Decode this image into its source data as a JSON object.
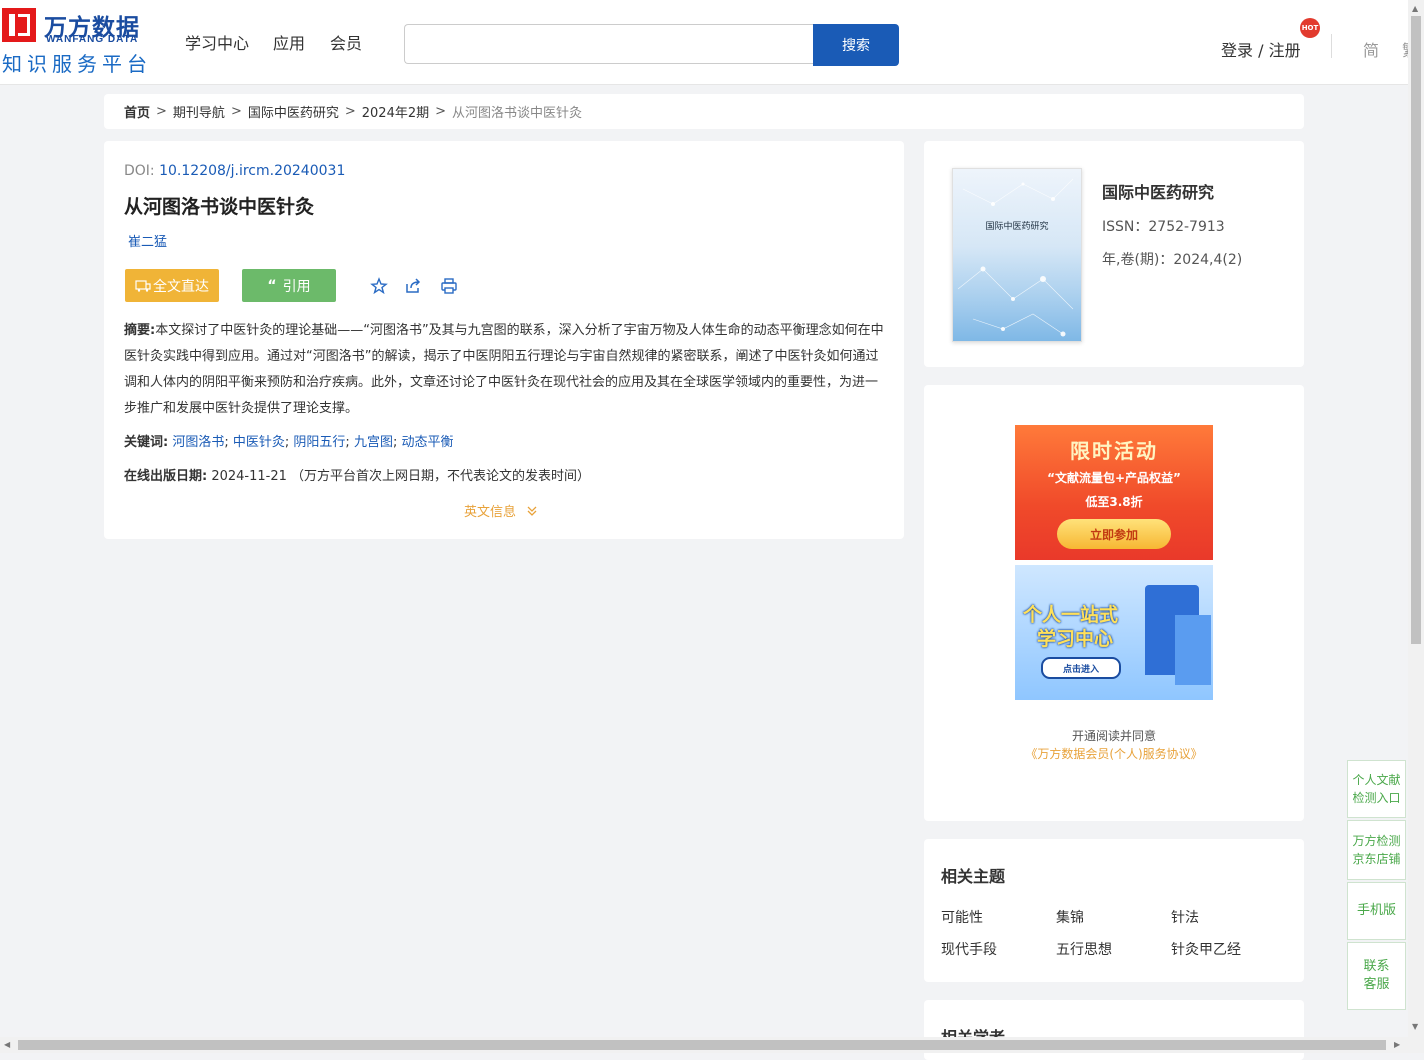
{
  "header": {
    "logo_cn": "万方数据",
    "logo_en": "WANFANG DATA",
    "logo_sub": "知识服务平台",
    "nav": [
      "学习中心",
      "应用",
      "会员"
    ],
    "search_placeholder": "",
    "search_button": "搜索",
    "login": "登录 / 注册",
    "hot_badge": "HOT",
    "lang": "简",
    "lang2": "繁"
  },
  "breadcrumb": {
    "items": [
      "首页",
      "期刊导航",
      "国际中医药研究",
      "2024年2期"
    ],
    "current": "从河图洛书谈中医针灸",
    "separator": ">"
  },
  "article": {
    "doi_label": "DOI: ",
    "doi": "10.12208/j.ircm.20240031",
    "title": "从河图洛书谈中医针灸",
    "author": "崔二猛",
    "btn_fulltext": "全文直达",
    "btn_cite": "引用",
    "abstract_label": "摘要:",
    "abstract": "本文探讨了中医针灸的理论基础——“河图洛书”及其与九宫图的联系，深入分析了宇宙万物及人体生命的动态平衡理念如何在中医针灸实践中得到应用。通过对“河图洛书”的解读，揭示了中医阴阳五行理论与宇宙自然规律的紧密联系，阐述了中医针灸如何通过调和人体内的阴阳平衡来预防和治疗疾病。此外，文章还讨论了中医针灸在现代社会的应用及其在全球医学领域内的重要性，为进一步推广和发展中医针灸提供了理论支撑。",
    "keywords_label": "关键词:",
    "keywords": [
      "河图洛书",
      "中医针灸",
      "阴阳五行",
      "九宫图",
      "动态平衡"
    ],
    "pubdate_label": "在线出版日期:",
    "pubdate": "2024-11-21",
    "pubdate_note": "（万方平台首次上网日期，不代表论文的发表时间）",
    "english_info": "英文信息"
  },
  "journal": {
    "cover_title": "国际中医药研究",
    "name": "国际中医药研究",
    "issn": "ISSN：2752-7913",
    "volume": "年,卷(期)：2024,4(2)"
  },
  "ads": {
    "promo_title": "限时活动",
    "promo_sub": "“文献流量包+产品权益”",
    "promo_sub2": "低至3.8折",
    "promo_button": "立即参加",
    "learn_title_1": "个人一站式",
    "learn_title_2": "学习中心",
    "learn_button": "点击进入",
    "note": "开通阅读并同意",
    "agreement": "《万方数据会员(个人)服务协议》"
  },
  "topics": {
    "heading": "相关主题",
    "items": [
      "可能性",
      "集锦",
      "针法",
      "现代手段",
      "五行思想",
      "针灸甲乙经"
    ]
  },
  "scholars": {
    "heading": "相关学者"
  },
  "float": {
    "item1": [
      "个人文献",
      "检测入口"
    ],
    "item2": [
      "万方检测",
      "京东店铺"
    ],
    "item3": "手机版",
    "item4": [
      "联系",
      "客服"
    ]
  },
  "colors": {
    "brand_blue": "#1a5bb6",
    "brand_red": "#e4191a",
    "fulltext_btn": "#f0b437",
    "cite_btn": "#6cba6a",
    "link_orange": "#e8a23a"
  }
}
